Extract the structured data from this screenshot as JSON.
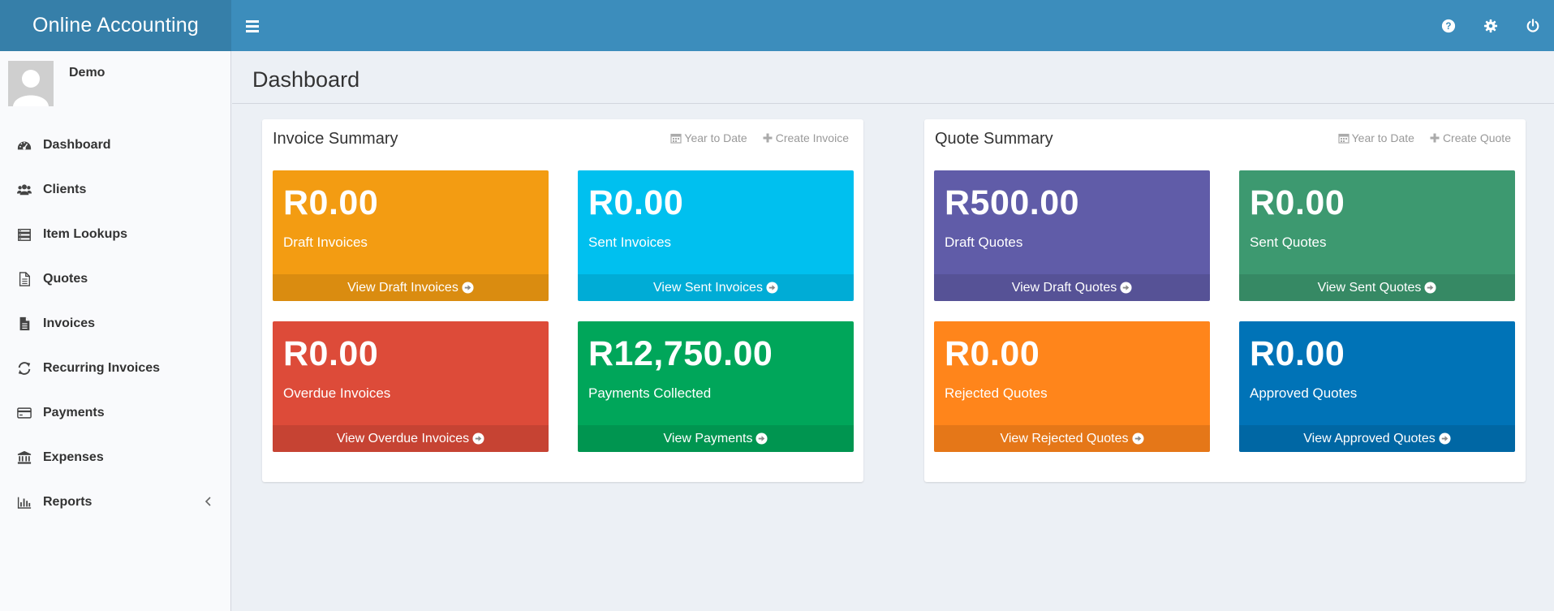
{
  "header": {
    "app_title": "Online Accounting",
    "menu_icon": "hamburger-icon",
    "icons": [
      "help-icon",
      "gear-icon",
      "power-icon"
    ]
  },
  "sidebar": {
    "user_name": "Demo",
    "items": [
      {
        "label": "Dashboard",
        "icon": "dashboard-icon"
      },
      {
        "label": "Clients",
        "icon": "users-icon"
      },
      {
        "label": "Item Lookups",
        "icon": "list-icon"
      },
      {
        "label": "Quotes",
        "icon": "file-icon"
      },
      {
        "label": "Invoices",
        "icon": "file-text-icon"
      },
      {
        "label": "Recurring Invoices",
        "icon": "refresh-icon"
      },
      {
        "label": "Payments",
        "icon": "credit-card-icon"
      },
      {
        "label": "Expenses",
        "icon": "bank-icon"
      },
      {
        "label": "Reports",
        "icon": "bar-chart-icon"
      }
    ]
  },
  "page": {
    "title": "Dashboard"
  },
  "invoice_summary": {
    "title": "Invoice Summary",
    "period_label": "Year to Date",
    "create_label": "Create Invoice",
    "tiles": [
      {
        "amount": "R0.00",
        "label": "Draft Invoices",
        "link": "View Draft Invoices",
        "color": "#f39c12"
      },
      {
        "amount": "R0.00",
        "label": "Sent Invoices",
        "link": "View Sent Invoices",
        "color": "#00c0ef"
      },
      {
        "amount": "R0.00",
        "label": "Overdue Invoices",
        "link": "View Overdue Invoices",
        "color": "#dd4b39"
      },
      {
        "amount": "R12,750.00",
        "label": "Payments Collected",
        "link": "View Payments",
        "color": "#00a65a"
      }
    ]
  },
  "quote_summary": {
    "title": "Quote Summary",
    "period_label": "Year to Date",
    "create_label": "Create Quote",
    "tiles": [
      {
        "amount": "R500.00",
        "label": "Draft Quotes",
        "link": "View Draft Quotes",
        "color": "#605ca8"
      },
      {
        "amount": "R0.00",
        "label": "Sent Quotes",
        "link": "View Sent Quotes",
        "color": "#3d9970"
      },
      {
        "amount": "R0.00",
        "label": "Rejected Quotes",
        "link": "View Rejected Quotes",
        "color": "#ff851b"
      },
      {
        "amount": "R0.00",
        "label": "Approved Quotes",
        "link": "View Approved Quotes",
        "color": "#0073b7"
      }
    ]
  }
}
